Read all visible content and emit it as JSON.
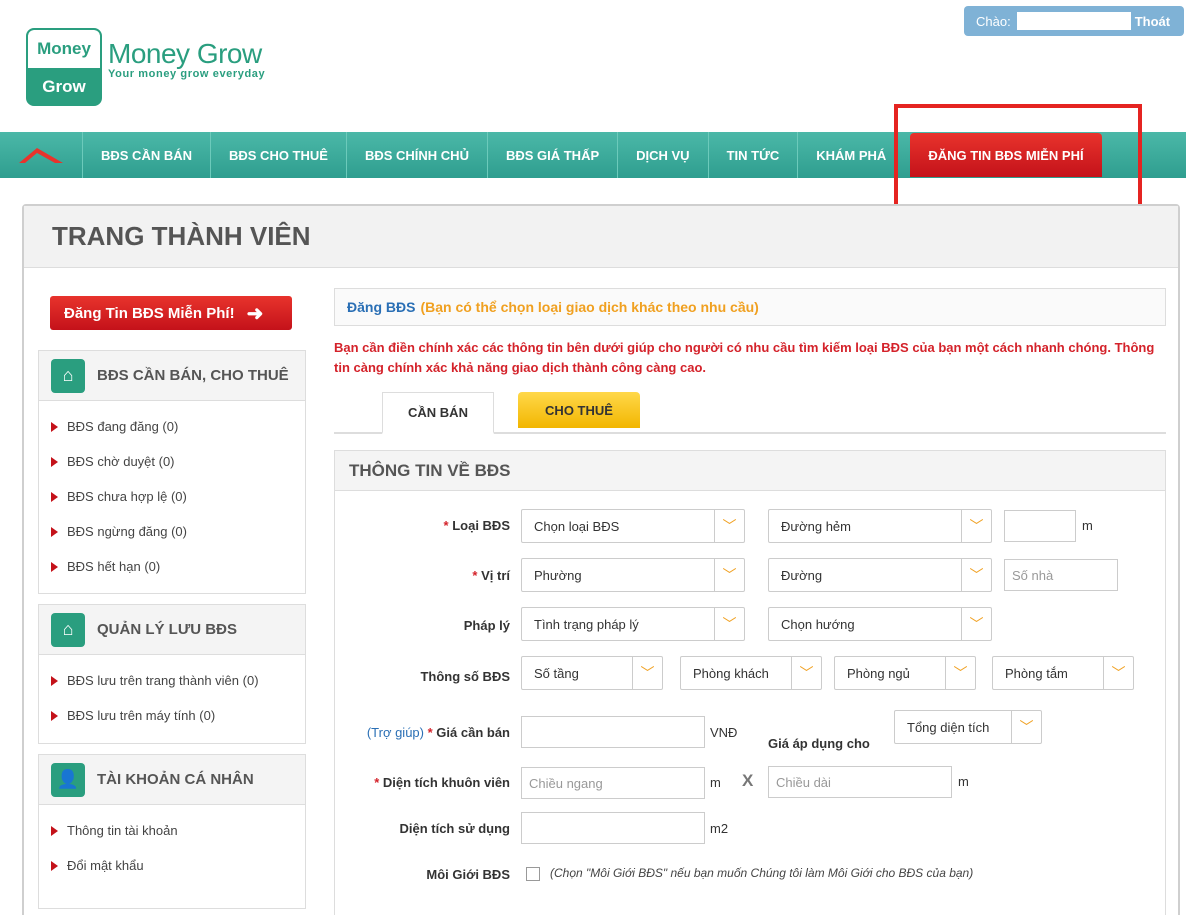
{
  "header": {
    "greeting": "Chào:",
    "logout": "Thoát",
    "logo_top": "Money",
    "logo_bottom": "Grow",
    "brand_name": "Money Grow",
    "tagline": "Your money grow everyday"
  },
  "nav": {
    "items": [
      "BĐS CẦN BÁN",
      "BĐS CHO THUÊ",
      "BĐS CHÍNH CHỦ",
      "BĐS GIÁ THẤP",
      "DỊCH VỤ",
      "TIN TỨC",
      "KHÁM PHÁ"
    ],
    "cta": "ĐĂNG TIN BĐS MIỄN PHÍ"
  },
  "page_title": "TRANG THÀNH VIÊN",
  "sidebar": {
    "post_button": "Đăng Tin BĐS Miễn Phí!",
    "sections": [
      {
        "title": "BĐS CẦN BÁN, CHO THUÊ",
        "items": [
          "BĐS đang đăng (0)",
          "BĐS chờ duyệt (0)",
          "BĐS chưa hợp lệ (0)",
          "BĐS ngừng đăng (0)",
          "BĐS hết hạn (0)"
        ]
      },
      {
        "title": "QUẢN LÝ LƯU BĐS",
        "items": [
          "BĐS lưu trên trang thành viên (0)",
          "BĐS lưu trên máy tính (0)"
        ]
      },
      {
        "title": "TÀI KHOẢN CÁ NHÂN",
        "items": [
          "Thông tin tài khoản",
          "Đổi mật khẩu"
        ]
      }
    ]
  },
  "main": {
    "head_a": "Đăng BĐS",
    "head_b": "(Bạn có thể chọn loại giao dịch khác theo nhu cầu)",
    "warning": "Bạn cần điền chính xác các thông tin bên dưới giúp cho người có nhu cầu tìm kiếm loại BĐS của bạn một cách nhanh chóng. Thông tin càng chính xác khả năng giao dịch thành công càng cao.",
    "tab_active": "CẦN BÁN",
    "tab_inactive": "CHO THUÊ",
    "info_title": "THÔNG TIN VỀ BĐS"
  },
  "form": {
    "loai_label": "Loại BĐS",
    "loai_select": "Chọn loại BĐS",
    "duong_hem": "Đường hẻm",
    "m1": "m",
    "vitri_label": "Vị trí",
    "phuong": "Phường",
    "duong": "Đường",
    "so_nha": "Số nhà",
    "phaply_label": "Pháp lý",
    "phaply_select": "Tình trạng pháp lý",
    "huong_select": "Chọn hướng",
    "thongso_label": "Thông số BĐS",
    "so_tang": "Số tầng",
    "phong_khach": "Phòng khách",
    "phong_ngu": "Phòng ngủ",
    "phong_tam": "Phòng tắm",
    "help_link": "(Trợ giúp)",
    "gia_label": "Giá cần bán",
    "vnd": "VNĐ",
    "gia_ap_dung": "Giá áp dụng cho",
    "tong_dien_tich": "Tổng diện tích",
    "dt_khuon_vien_label": "Diện tích khuôn viên",
    "chieu_ngang": "Chiều ngang",
    "m2": "m",
    "x": "X",
    "chieu_dai": "Chiều dài",
    "m3": "m",
    "dt_su_dung_label": "Diện tích sử dụng",
    "m2_unit": "m2",
    "moi_gioi_label": "Môi Giới BĐS",
    "moi_gioi_note": "(Chọn \"Môi Giới BĐS\" nếu bạn muốn Chúng tôi làm Môi Giới cho BĐS của bạn)"
  },
  "colors": {
    "brand_green": "#2a9e7f",
    "nav_teal": "#3aab9b",
    "cta_red": "#d42024",
    "tab_yellow": "#f7c520",
    "highlight_red": "#e52421"
  }
}
